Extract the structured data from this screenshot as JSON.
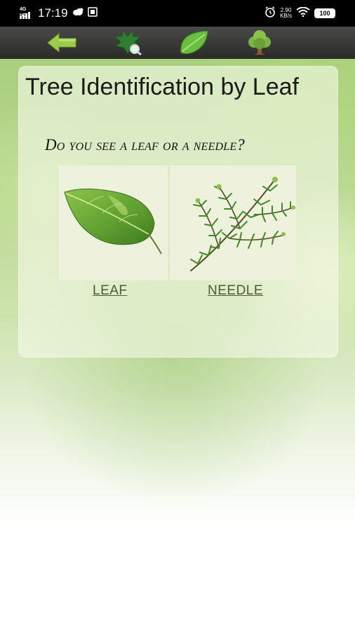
{
  "status_bar": {
    "network": "4G HD",
    "time": "17:19",
    "speed": "2.90",
    "speed_unit": "KB/s",
    "battery": "100"
  },
  "toolbar": {
    "buttons": [
      {
        "name": "back-arrow-icon"
      },
      {
        "name": "leaf-magnifier-icon"
      },
      {
        "name": "green-leaf-icon"
      },
      {
        "name": "tree-icon"
      }
    ]
  },
  "page": {
    "title": "Tree Identification by Leaf",
    "question": "Do you see a leaf or a needle?"
  },
  "choices": [
    {
      "label": "LEAF"
    },
    {
      "label": "NEEDLE"
    }
  ],
  "colors": {
    "toolbar": "#3a3a38",
    "accent_green": "#7cb342",
    "link_text": "#4d5a33"
  }
}
